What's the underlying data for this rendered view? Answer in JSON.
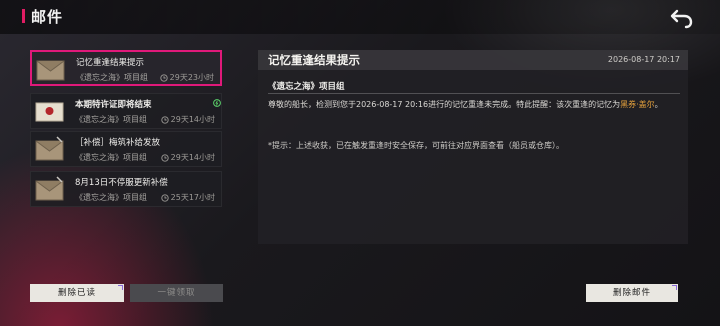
{
  "header": {
    "title": "邮件"
  },
  "mail_list": [
    {
      "title": "记忆重逢结果提示",
      "sender": "《遗忘之海》项目组",
      "time_left": "29天23小时",
      "selected": true
    },
    {
      "title": "本期特许证即将结束",
      "sender": "《遗忘之海》项目组",
      "time_left": "29天14小时",
      "selected": false
    },
    {
      "title": "［补偿］梅筑补给发放",
      "sender": "《遗忘之海》项目组",
      "time_left": "29天14小时",
      "selected": false
    },
    {
      "title": "8月13日不停服更新补偿",
      "sender": "《遗忘之海》项目组",
      "time_left": "25天17小时",
      "selected": false
    }
  ],
  "buttons": {
    "delete_read": "删除已读",
    "claim_all": "一键领取",
    "delete_mail": "删除邮件"
  },
  "detail": {
    "title": "记忆重逢结果提示",
    "date": "2026-08-17 20:17",
    "sender": "《遗忘之海》项目组",
    "body_part1": "尊敬的船长，检测到您于2026-08-17 20:16进行的记忆重逢未完成。特此提醒：该次重逢的记忆为",
    "body_highlight": "黑券·盖尔",
    "body_part2": "。",
    "note": "*提示：上述收获，已在触发重逢时安全保存，可前往对应界面查看（船员或仓库）。"
  },
  "colors": {
    "accent": "#e01c63",
    "highlight": "#e6a23c",
    "selected_border": "#e0197a"
  },
  "icons": [
    "back-arrow-icon",
    "envelope-icon",
    "sealed-letter-icon",
    "clock-icon",
    "notification-icon"
  ]
}
